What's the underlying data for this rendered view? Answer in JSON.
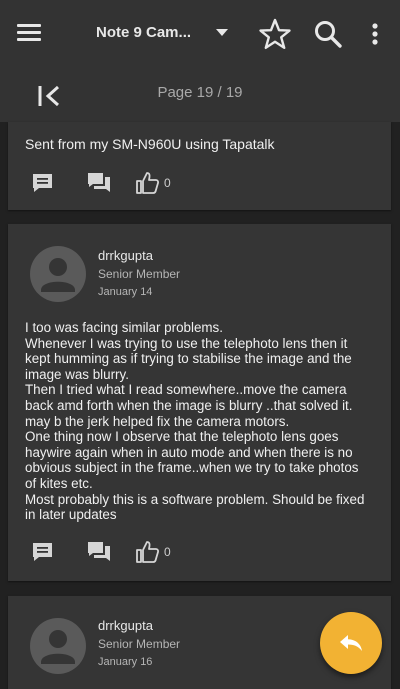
{
  "appbar": {
    "title": "Note 9 Cam...",
    "icons": [
      "menu-icon",
      "dropdown-icon",
      "star-icon",
      "search-icon",
      "more-icon"
    ]
  },
  "pager": {
    "label": "Page 19 / 19",
    "icon": "first-page-icon"
  },
  "posts": [
    {
      "signature": "Sent from my SM-N960U using Tapatalk",
      "likes": "0"
    },
    {
      "author": "drrkgupta",
      "role": "Senior Member",
      "date": "January 14",
      "body": [
        "I too was facing similar problems.",
        "Whenever I was trying to use the telephoto lens then it",
        "kept humming as if trying to stabilise the image and the",
        "image was blurry.",
        "Then I tried what I read somewhere..move the camera",
        "back amd forth when the image is blurry ..that solved it.",
        "may b the jerk helped fix the camera motors.",
        "One thing now I observe that the telephoto lens goes",
        "haywire again when in auto mode and when there is no",
        "obvious subject in the frame..when we try to take photos",
        "of kites etc.",
        "Most probably this is a software problem. Should be fixed",
        "in later updates"
      ],
      "likes": "0"
    },
    {
      "author": "drrkgupta",
      "role": "Senior Member",
      "date": "January 16"
    }
  ],
  "colors": {
    "fab": "#f2b233",
    "background": "#212121",
    "card": "#353535",
    "bar": "#333333"
  }
}
